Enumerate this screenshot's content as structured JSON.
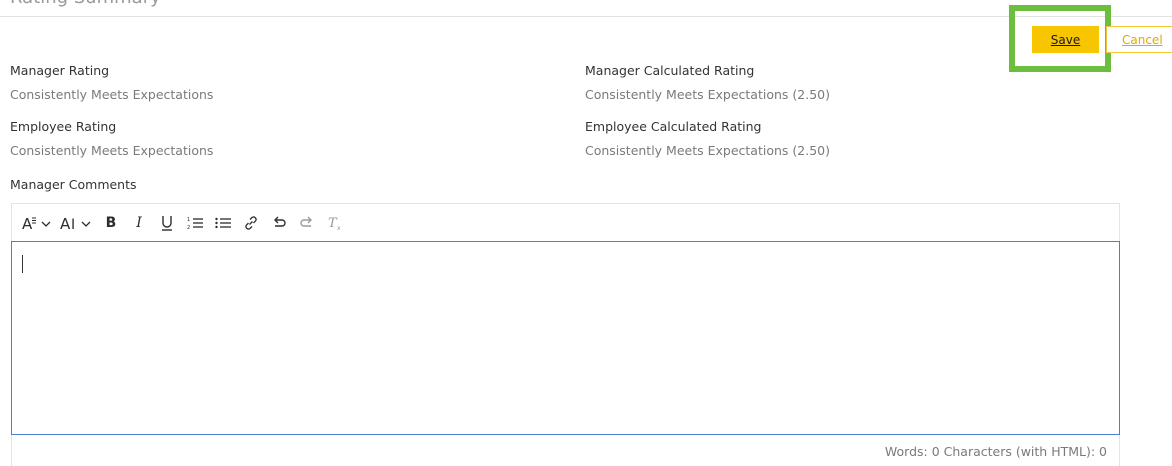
{
  "header": {
    "title": "Rating Summary"
  },
  "actions": {
    "save_label": "Save",
    "cancel_label": "Cancel",
    "highlight_color": "#6cbf3e",
    "save_color": "#f7c600"
  },
  "ratings": {
    "manager_rating": {
      "label": "Manager Rating",
      "value": "Consistently Meets Expectations"
    },
    "employee_rating": {
      "label": "Employee Rating",
      "value": "Consistently Meets Expectations"
    },
    "manager_calculated": {
      "label": "Manager Calculated Rating",
      "value": "Consistently Meets Expectations (2.50)"
    },
    "employee_calculated": {
      "label": "Employee Calculated Rating",
      "value": "Consistently Meets Expectations (2.50)"
    }
  },
  "comments": {
    "label": "Manager Comments",
    "value": "",
    "toolbar": [
      "font-format-icon",
      "font-size-icon",
      "bold-icon",
      "italic-icon",
      "underline-icon",
      "numbered-list-icon",
      "bulleted-list-icon",
      "link-icon",
      "undo-icon",
      "redo-icon",
      "clear-format-icon"
    ],
    "status": "Words: 0 Characters (with HTML): 0"
  }
}
